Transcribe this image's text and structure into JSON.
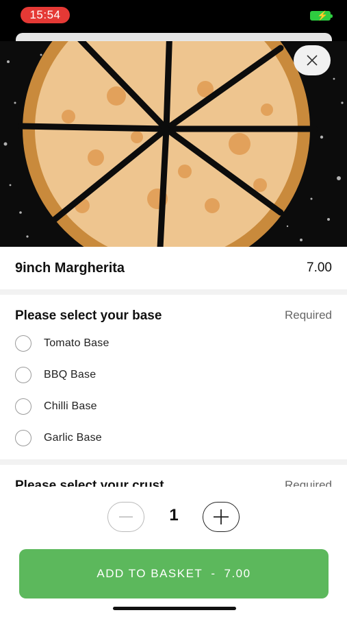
{
  "status_bar": {
    "time": "15:54",
    "colors": {
      "time_pill": "#e53935",
      "battery": "#2ecc40"
    }
  },
  "item": {
    "name": "9inch Margherita",
    "price": "7.00"
  },
  "groups": [
    {
      "title": "Please select your base",
      "required_label": "Required",
      "options": [
        {
          "label": "Tomato Base"
        },
        {
          "label": "BBQ Base"
        },
        {
          "label": "Chilli Base"
        },
        {
          "label": "Garlic Base"
        }
      ]
    },
    {
      "title": "Please select your crust",
      "required_label": "Required"
    }
  ],
  "quantity": "1",
  "add_button": {
    "label": "ADD TO BASKET",
    "separator": "-",
    "amount": "7.00"
  },
  "icons": {
    "close": "close-icon",
    "minus": "minus-icon",
    "plus": "plus-icon",
    "battery": "battery-charging-icon"
  },
  "colors": {
    "accent": "#5cb85c",
    "text": "#111111",
    "muted": "#666666",
    "divider": "#f2f2f2"
  }
}
